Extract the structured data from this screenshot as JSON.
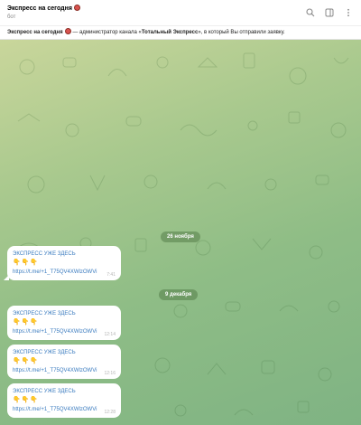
{
  "header": {
    "title": "Экспресс на сегодня",
    "subtitle": "бот",
    "icons": [
      "search-icon",
      "sidebar-toggle-icon",
      "more-vertical-icon"
    ]
  },
  "banner": {
    "name": "Экспресс на сегодня",
    "text_mid": " — администратор канала «",
    "channel": "Тотальный Экспресс",
    "text_end": "», в который Вы отправили заявку."
  },
  "dates": [
    "26 ноября",
    "9 декабря"
  ],
  "messages": [
    {
      "title": "ЭКСПРЕСС УЖЕ ЗДЕСЬ",
      "hands": "👇👇👇",
      "link": "https://t.me/+1_T75QV4XWlzOWVi",
      "time": "7:41"
    },
    {
      "title": "ЭКСПРЕСС УЖЕ ЗДЕСЬ",
      "hands": "👇👇👇",
      "link": "https://t.me/+1_T75QV4XWlzOWVi",
      "time": "12:14"
    },
    {
      "title": "ЭКСПРЕСС УЖЕ ЗДЕСЬ",
      "hands": "👇👇👇",
      "link": "https://t.me/+1_T75QV4XWlzOWVi",
      "time": "12:16"
    },
    {
      "title": "ЭКСПРЕСС УЖЕ ЗДЕСЬ",
      "hands": "👇👇👇",
      "link": "https://t.me/+1_T75QV4XWlzOWVi",
      "time": "12:28"
    }
  ],
  "colors": {
    "link": "#3a7bbf",
    "hands": "#e8b33a",
    "wallpaper": "#8fbd86"
  }
}
